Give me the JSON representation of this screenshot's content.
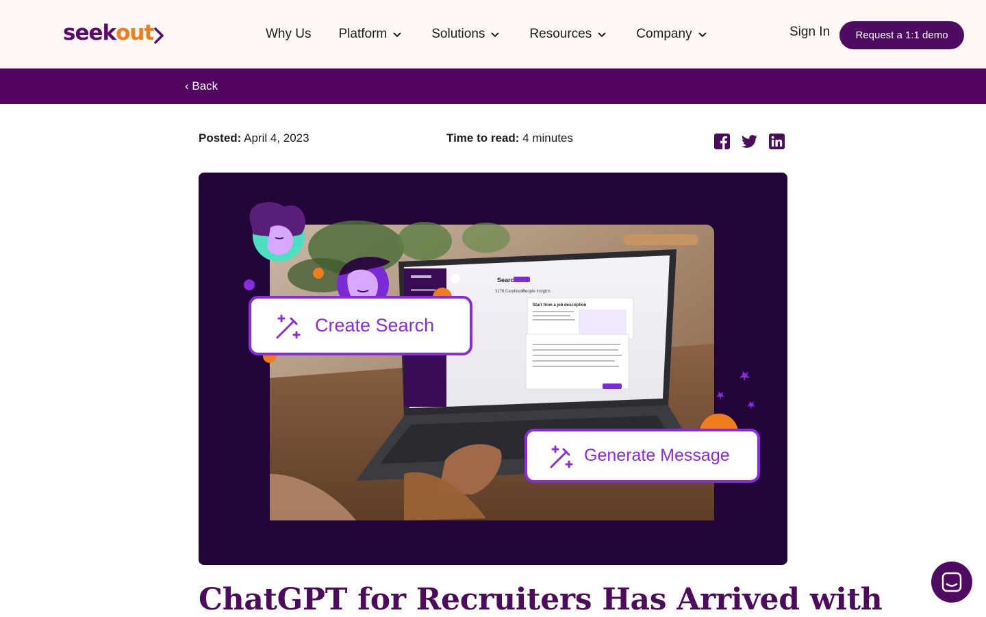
{
  "header": {
    "logo": {
      "part1": "seek",
      "part2": "out"
    },
    "nav": [
      {
        "label": "Why Us",
        "dropdown": false
      },
      {
        "label": "Platform",
        "dropdown": true
      },
      {
        "label": "Solutions",
        "dropdown": true
      },
      {
        "label": "Resources",
        "dropdown": true
      },
      {
        "label": "Company",
        "dropdown": true
      }
    ],
    "sign_in": "Sign In",
    "demo_button": "Request a 1:1 demo"
  },
  "back": {
    "label": "‹ Back"
  },
  "meta": {
    "posted_label": "Posted:",
    "posted_value": "April 4, 2023",
    "read_label": "Time to read:",
    "read_value": "4 minutes"
  },
  "share": [
    "facebook-icon",
    "twitter-icon",
    "linkedin-icon"
  ],
  "hero": {
    "search_pill": "Search",
    "tab_candidates": "3176 Candidates",
    "tab_insights": "People Insights",
    "panel_heading": "Start from a job description",
    "create_search": "Create Search",
    "generate_message": "Generate Message"
  },
  "article": {
    "title": "ChatGPT for Recruiters Has Arrived with"
  },
  "colors": {
    "brand_purple": "#530460",
    "button_purple": "#4f0a62",
    "brand_orange": "#f07d1c",
    "header_bg": "#fff8f4",
    "hero_bg": "#22063a",
    "accent_violet": "#8a2be2"
  }
}
